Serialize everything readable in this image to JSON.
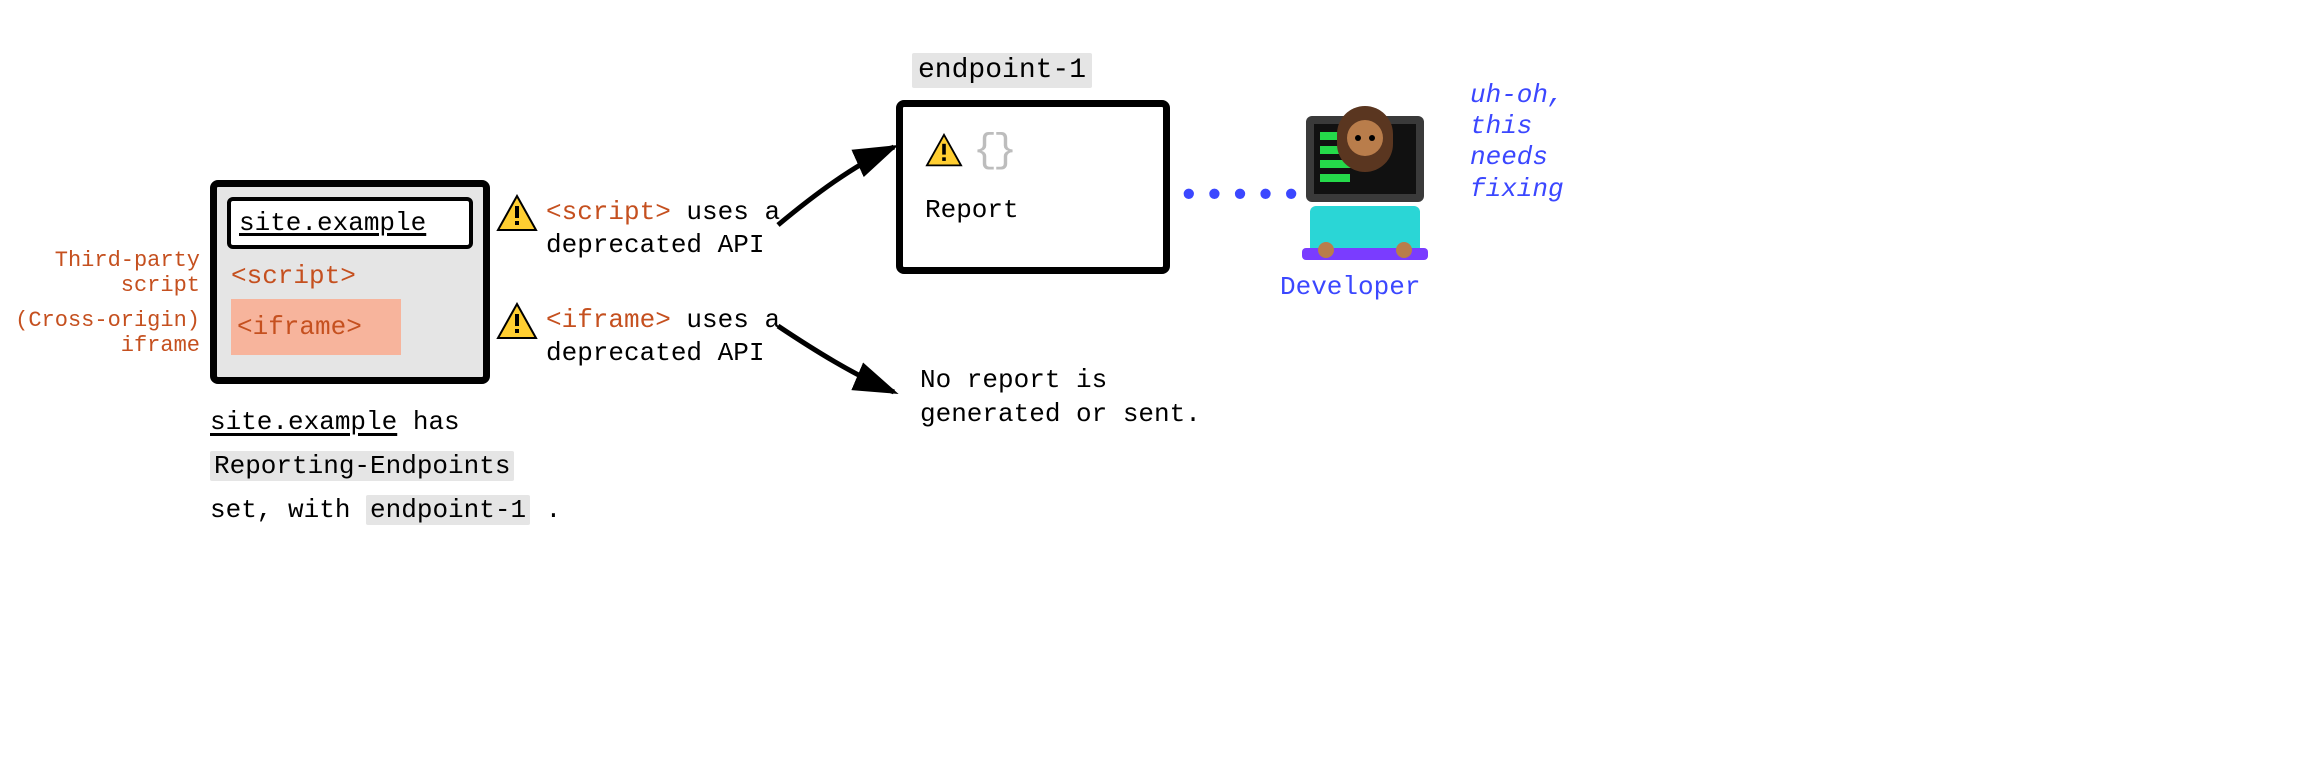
{
  "browser": {
    "url": "site.example",
    "script_tag": "<script>",
    "iframe_tag": "<iframe>"
  },
  "labels": {
    "third_party_line1": "Third-party",
    "third_party_line2": "script",
    "cross_origin_line1": "(Cross-origin)",
    "cross_origin_line2": "iframe"
  },
  "messages": {
    "m1_code": "<script>",
    "m1_rest": " uses a",
    "m1_line2": "deprecated API",
    "m2_code": "<iframe>",
    "m2_rest": " uses a",
    "m2_line2": "deprecated API"
  },
  "endpoint": {
    "title": "endpoint-1",
    "braces": "{}",
    "report_label": "Report"
  },
  "no_report": {
    "line1": "No report is",
    "line2": "generated or sent."
  },
  "developer": {
    "dots": "••••••",
    "label": "Developer",
    "thought_l1": "uh-oh,",
    "thought_l2": "this",
    "thought_l3": "needs",
    "thought_l4": "fixing"
  },
  "caption": {
    "c1_a": "site.example",
    "c1_b": " has",
    "c2": "Reporting-Endpoints",
    "c3_a": "set, with ",
    "c3_b": "endpoint-1",
    "c3_c": " ."
  },
  "icons": {
    "warn": "warning-triangle",
    "braces": "curly-braces"
  },
  "colors": {
    "orange": "#c5501f",
    "blue": "#3b47ff",
    "hl_bg": "#e5e5e5",
    "hl_peach": "#f7b49c"
  }
}
